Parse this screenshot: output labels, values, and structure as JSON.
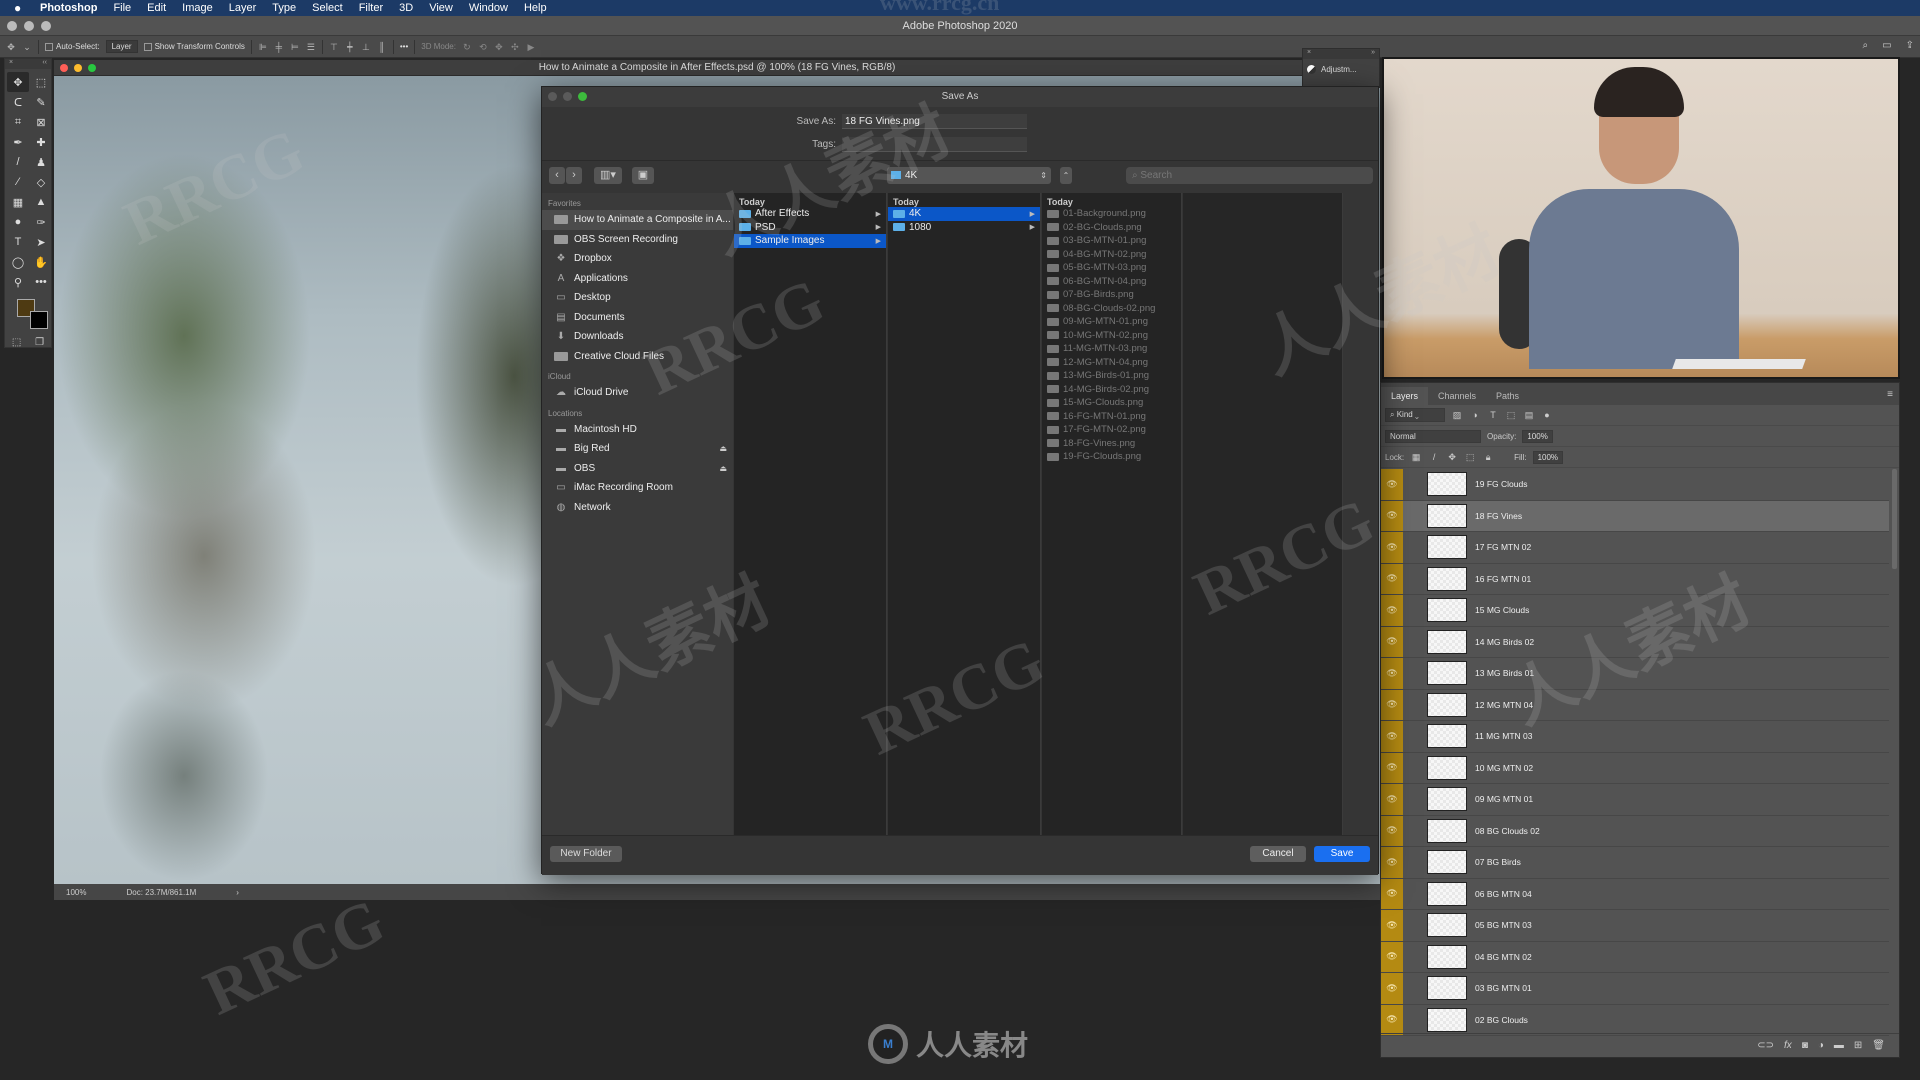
{
  "menubar": {
    "apple_icon": "apple-logo",
    "items": [
      "Photoshop",
      "File",
      "Edit",
      "Image",
      "Layer",
      "Type",
      "Select",
      "Filter",
      "3D",
      "View",
      "Window",
      "Help"
    ]
  },
  "app_title": "Adobe Photoshop 2020",
  "options_bar": {
    "auto_select_label": "Auto-Select:",
    "auto_select_checked": false,
    "auto_select_target": "Layer",
    "show_transform_label": "Show Transform Controls",
    "show_transform_checked": false,
    "mode_3d_label": "3D Mode:",
    "more_label": "•••"
  },
  "tools": {
    "panel_close": "×",
    "panel_collapse": "‹‹",
    "icons": [
      {
        "name": "move-tool",
        "glyph": "✥"
      },
      {
        "name": "marquee-tool",
        "glyph": "⬚"
      },
      {
        "name": "lasso-tool",
        "glyph": "ᑕ"
      },
      {
        "name": "magic-wand-tool",
        "glyph": "✎"
      },
      {
        "name": "crop-tool",
        "glyph": "⌗"
      },
      {
        "name": "frame-tool",
        "glyph": "⊠"
      },
      {
        "name": "eyedropper-tool",
        "glyph": "✒"
      },
      {
        "name": "healing-brush-tool",
        "glyph": "✚"
      },
      {
        "name": "brush-tool",
        "glyph": "/"
      },
      {
        "name": "clone-stamp-tool",
        "glyph": "♟"
      },
      {
        "name": "history-brush-tool",
        "glyph": "⁄"
      },
      {
        "name": "eraser-tool",
        "glyph": "◇"
      },
      {
        "name": "gradient-tool",
        "glyph": "▦"
      },
      {
        "name": "blur-tool",
        "glyph": "▲"
      },
      {
        "name": "dodge-tool",
        "glyph": "●"
      },
      {
        "name": "pen-tool",
        "glyph": "✑"
      },
      {
        "name": "type-tool",
        "glyph": "T"
      },
      {
        "name": "path-selection-tool",
        "glyph": "➤"
      },
      {
        "name": "ellipse-tool",
        "glyph": "◯"
      },
      {
        "name": "hand-tool",
        "glyph": "✋"
      },
      {
        "name": "zoom-tool",
        "glyph": "⚲"
      },
      {
        "name": "more-tools",
        "glyph": "•••"
      }
    ],
    "foreground_color": "#4e3a12",
    "background_color": "#000000"
  },
  "document": {
    "title": "How to Animate a Composite in After Effects.psd @ 100% (18 FG Vines, RGB/8)",
    "zoom": "100%",
    "doc_size": "Doc: 23.7M/861.1M",
    "status_arrow": "›"
  },
  "adjustments_panel": {
    "close": "×",
    "expand": "»",
    "label": "Adjustm..."
  },
  "save_dialog": {
    "title": "Save As",
    "save_as_label": "Save As:",
    "save_as_value": "18 FG Vines.png",
    "tags_label": "Tags:",
    "tags_value": "",
    "back_label": "‹",
    "forward_label": "›",
    "view_label": "▥▾",
    "new_folder_icon_label": "▣",
    "location": "4K",
    "location_arrows": "⇕",
    "up_label": "⌃",
    "search_placeholder": "Search",
    "sidebar": {
      "sections": [
        {
          "title": "Favorites",
          "items": [
            {
              "label": "How to Animate a Composite in A...",
              "icon": "folder-icon",
              "selected": true
            },
            {
              "label": "OBS Screen Recording",
              "icon": "folder-icon"
            },
            {
              "label": "Dropbox",
              "icon": "dropbox-icon"
            },
            {
              "label": "Applications",
              "icon": "applications-icon"
            },
            {
              "label": "Desktop",
              "icon": "desktop-icon"
            },
            {
              "label": "Documents",
              "icon": "documents-icon"
            },
            {
              "label": "Downloads",
              "icon": "downloads-icon"
            },
            {
              "label": "Creative Cloud Files",
              "icon": "folder-icon"
            }
          ]
        },
        {
          "title": "iCloud",
          "items": [
            {
              "label": "iCloud Drive",
              "icon": "cloud-icon"
            }
          ]
        },
        {
          "title": "Locations",
          "items": [
            {
              "label": "Macintosh HD",
              "icon": "disk-icon"
            },
            {
              "label": "Big Red",
              "icon": "disk-icon",
              "eject": true
            },
            {
              "label": "OBS",
              "icon": "disk-icon",
              "eject": true
            },
            {
              "label": "iMac Recording Room",
              "icon": "computer-icon"
            },
            {
              "label": "Network",
              "icon": "network-icon"
            }
          ]
        }
      ]
    },
    "columns": [
      {
        "header": "Today",
        "items": [
          {
            "label": "After Effects",
            "folder": true
          },
          {
            "label": "PSD",
            "folder": true
          },
          {
            "label": "Sample Images",
            "folder": true,
            "selected": true
          }
        ]
      },
      {
        "header": "Today",
        "items": [
          {
            "label": "4K",
            "folder": true,
            "selected": true
          },
          {
            "label": "1080",
            "folder": true
          }
        ]
      },
      {
        "header": "Today",
        "items": [
          {
            "label": "01-Background.png"
          },
          {
            "label": "02-BG-Clouds.png"
          },
          {
            "label": "03-BG-MTN-01.png"
          },
          {
            "label": "04-BG-MTN-02.png"
          },
          {
            "label": "05-BG-MTN-03.png"
          },
          {
            "label": "06-BG-MTN-04.png"
          },
          {
            "label": "07-BG-Birds.png"
          },
          {
            "label": "08-BG-Clouds-02.png"
          },
          {
            "label": "09-MG-MTN-01.png"
          },
          {
            "label": "10-MG-MTN-02.png"
          },
          {
            "label": "11-MG-MTN-03.png"
          },
          {
            "label": "12-MG-MTN-04.png"
          },
          {
            "label": "13-MG-Birds-01.png"
          },
          {
            "label": "14-MG-Birds-02.png"
          },
          {
            "label": "15-MG-Clouds.png"
          },
          {
            "label": "16-FG-MTN-01.png"
          },
          {
            "label": "17-FG-MTN-02.png"
          },
          {
            "label": "18-FG-Vines.png"
          },
          {
            "label": "19-FG-Clouds.png"
          }
        ]
      }
    ],
    "new_folder_label": "New Folder",
    "cancel_label": "Cancel",
    "save_label": "Save"
  },
  "layers_panel": {
    "tabs": [
      "Layers",
      "Channels",
      "Paths"
    ],
    "active_tab": "Layers",
    "menu_icon": "≡",
    "filter_kind": "Kind",
    "blend_mode": "Normal",
    "opacity_label": "Opacity:",
    "opacity_value": "100%",
    "lock_label": "Lock:",
    "fill_label": "Fill:",
    "fill_value": "100%",
    "layers": [
      {
        "name": "19 FG Clouds",
        "visible": true
      },
      {
        "name": "18 FG Vines",
        "visible": true,
        "selected": true
      },
      {
        "name": "17 FG MTN 02",
        "visible": true
      },
      {
        "name": "16 FG MTN 01",
        "visible": true
      },
      {
        "name": "15 MG Clouds",
        "visible": true
      },
      {
        "name": "14 MG Birds 02",
        "visible": true
      },
      {
        "name": "13 MG Birds 01",
        "visible": true
      },
      {
        "name": "12 MG MTN 04",
        "visible": true
      },
      {
        "name": "11 MG MTN 03",
        "visible": true
      },
      {
        "name": "10 MG MTN 02",
        "visible": true
      },
      {
        "name": "09 MG MTN 01",
        "visible": true
      },
      {
        "name": "08 BG Clouds 02",
        "visible": true
      },
      {
        "name": "07 BG Birds",
        "visible": true
      },
      {
        "name": "06 BG MTN 04",
        "visible": true
      },
      {
        "name": "05 BG MTN 03",
        "visible": true
      },
      {
        "name": "04 BG MTN 02",
        "visible": true
      },
      {
        "name": "03 BG MTN 01",
        "visible": true
      },
      {
        "name": "02 BG Clouds",
        "visible": true
      }
    ],
    "footer_icons": [
      "link-icon",
      "fx-icon",
      "mask-icon",
      "adjustment-icon",
      "group-icon",
      "new-layer-icon",
      "trash-icon"
    ]
  },
  "watermarks": {
    "texts": [
      "RRCG",
      "人人素材",
      "www.rrcg.cn"
    ],
    "brand": "人人素材"
  },
  "colors": {
    "menubar": "#1c3a66",
    "selection_blue": "#0b57c8",
    "save_button": "#1a6ff0",
    "eye_column": "#b48a12"
  }
}
